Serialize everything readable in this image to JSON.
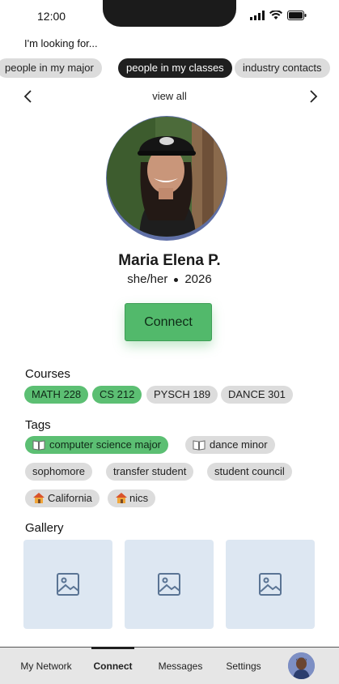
{
  "status_bar": {
    "time": "12:00",
    "signal_icon": "signal-icon",
    "wifi_icon": "wifi-icon",
    "battery_icon": "battery-icon"
  },
  "filters": {
    "label": "I'm looking for...",
    "chips": [
      {
        "label": "people in my major",
        "selected": false
      },
      {
        "label": "people in my classes",
        "selected": true
      },
      {
        "label": "industry contacts",
        "selected": false
      }
    ]
  },
  "carousel": {
    "prev_icon": "chevron-left-icon",
    "view_all": "view all",
    "next_icon": "chevron-right-icon"
  },
  "profile": {
    "name": "Maria Elena P.",
    "pronouns": "she/her",
    "year": "2026",
    "connect_label": "Connect"
  },
  "courses": {
    "title": "Courses",
    "items": [
      {
        "label": "MATH 228",
        "shared": true
      },
      {
        "label": "CS 212",
        "shared": true
      },
      {
        "label": "PYSCH 189",
        "shared": false
      },
      {
        "label": "DANCE 301",
        "shared": false
      }
    ]
  },
  "tags": {
    "title": "Tags",
    "items": [
      {
        "label": "computer science major",
        "icon": "book-icon",
        "shared": true
      },
      {
        "label": "dance minor",
        "icon": "book-icon",
        "shared": false
      },
      {
        "label": "sophomore",
        "shared": false
      },
      {
        "label": "transfer student",
        "shared": false
      },
      {
        "label": "student council",
        "shared": false
      },
      {
        "label": "California",
        "icon": "house-icon",
        "shared": false
      },
      {
        "label": "nics",
        "icon": "house-icon",
        "shared": false
      }
    ]
  },
  "gallery": {
    "title": "Gallery",
    "tiles": 3,
    "tile_icon": "image-placeholder-icon"
  },
  "tab_bar": {
    "items": [
      "My Network",
      "Connect",
      "Messages",
      "Settings"
    ],
    "active": "Connect"
  },
  "colors": {
    "accent_green": "#52b96b",
    "chip_dark": "#1f1f1f",
    "chip_gray": "#dcdcdc",
    "avatar_ring": "#5f6fa6",
    "gallery_tile": "#dde7f2"
  }
}
